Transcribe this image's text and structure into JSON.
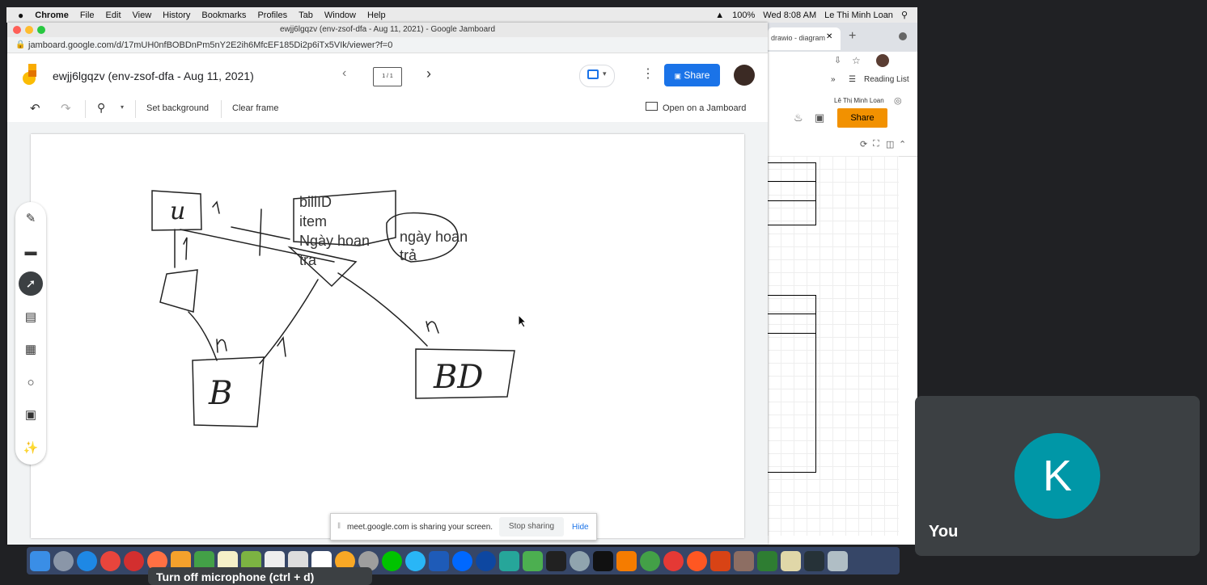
{
  "menubar": {
    "apple": "",
    "app": "Chrome",
    "items": [
      "File",
      "Edit",
      "View",
      "History",
      "Bookmarks",
      "Profiles",
      "Tab",
      "Window",
      "Help"
    ],
    "battery": "100%",
    "datetime": "Wed 8:08 AM",
    "user": "Le Thi Minh Loan"
  },
  "window": {
    "title": "ewjj6lgqzv (env-zsof-dfa - Aug 11, 2021) - Google Jamboard",
    "url": "jamboard.google.com/d/17mUH0nfBOBDnPm5nY2E2ih6MfcEF185Di2p6iTx5VIk/viewer?f=0"
  },
  "jamboard": {
    "doc_title": "ewjj6lgqzv (env-zsof-dfa - Aug 11, 2021)",
    "frame_counter": "1 / 1",
    "share_label": "Share",
    "toolbar": {
      "set_background": "Set background",
      "clear_frame": "Clear frame",
      "open_on_jamboard": "Open on a Jamboard"
    }
  },
  "drawing": {
    "text_block_1": [
      "billID",
      "item",
      "Ngày hoan",
      "tra"
    ],
    "text_block_2": [
      "ngày hoan",
      "trả"
    ],
    "entity_u": "u",
    "entity_b": "B",
    "entity_bd": "BD",
    "card_1": "1",
    "card_1b": "1",
    "card_n_b": "n",
    "card_1_b": "1",
    "card_n_bd": "n"
  },
  "backwindow": {
    "tab_label": "drawio - diagram",
    "reading_list": "Reading List",
    "user": "Lê Thị Minh Loan",
    "share_label": "Share"
  },
  "sharing": {
    "message": "meet.google.com is sharing your screen.",
    "stop_label": "Stop sharing",
    "hide_label": "Hide"
  },
  "meet": {
    "avatar_letter": "K",
    "name": "You",
    "mic_tooltip": "Turn off microphone (ctrl + d)"
  },
  "colors": {
    "share_blue": "#1a73e8",
    "avatar_teal": "#0097a7",
    "drawio_orange": "#f29100"
  }
}
